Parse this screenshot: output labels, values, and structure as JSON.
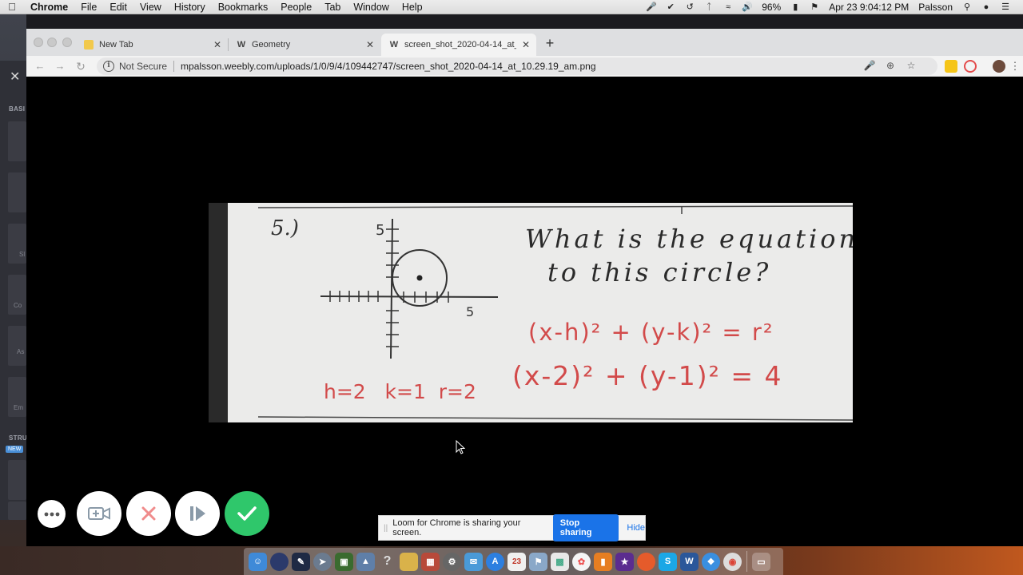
{
  "menubar": {
    "app": "Chrome",
    "items": [
      "File",
      "Edit",
      "View",
      "History",
      "Bookmarks",
      "People",
      "Tab",
      "Window",
      "Help"
    ],
    "battery": "96%",
    "datetime": "Apr 23  9:04:12 PM",
    "user": "Palsson"
  },
  "tabs": [
    {
      "title": "New Tab",
      "icon": "new-tab-favicon"
    },
    {
      "title": "Geometry",
      "icon": "weebly-favicon"
    },
    {
      "title": "screen_shot_2020-04-14_at_1(",
      "icon": "weebly-favicon"
    }
  ],
  "address": {
    "security": "Not Secure",
    "url": "mpalsson.weebly.com/uploads/1/0/9/4/109442747/screen_shot_2020-04-14_at_10.29.19_am.png"
  },
  "behind_panel": {
    "labels": [
      "BASI",
      "STRU"
    ],
    "new_badge": "NEW",
    "tile_labels": [
      "Sl",
      "Co",
      "As",
      "Em"
    ]
  },
  "image": {
    "problem_number": "5.)",
    "question_line1": "What is the equation",
    "question_line2": "to this circle?",
    "axis_label_y": "5",
    "axis_label_x": "5",
    "formula": "(x-h)² + (y-k)² = r²",
    "answer": "(x-2)² + (y-1)² = 4",
    "values": "h=2   k=1  r=2"
  },
  "share_bar": {
    "message": "Loom for Chrome is sharing your screen.",
    "stop_label": "Stop sharing",
    "hide_label": "Hide"
  },
  "colors": {
    "loom_done": "#2fc76b",
    "loom_cancel": "#f08c8c",
    "stop_button": "#1a73e8",
    "ink_red": "#d24a4a"
  }
}
